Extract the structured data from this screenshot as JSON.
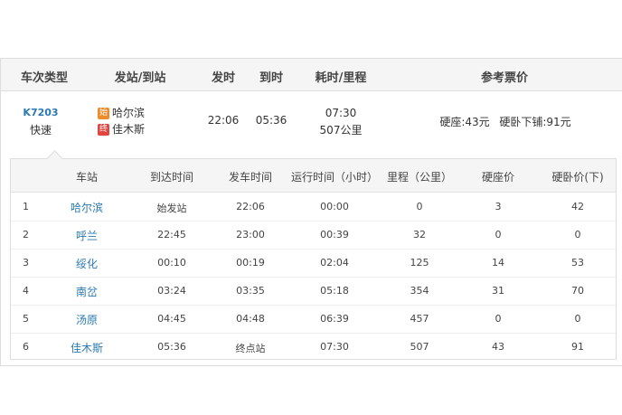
{
  "header": {
    "train_type": "车次类型",
    "from_to": "发站/到站",
    "depart": "发时",
    "arrive": "到时",
    "duration_distance": "耗时/里程",
    "fare": "参考票价"
  },
  "train": {
    "code": "K7203",
    "type": "快速",
    "from_badge": "始",
    "from_station": "哈尔滨",
    "to_badge": "终",
    "to_station": "佳木斯",
    "depart_time": "22:06",
    "arrive_time": "05:36",
    "duration": "07:30",
    "distance": "507公里",
    "fare_hard_seat": "硬座:43元",
    "fare_hard_sleeper": "硬卧下铺:91元"
  },
  "stops_header": {
    "station": "车站",
    "arrive": "到达时间",
    "depart": "发车时间",
    "run_time": "运行时间（小时）",
    "distance": "里程（公里）",
    "hard_seat": "硬座价",
    "hard_sleeper": "硬卧价(下)"
  },
  "stops": [
    {
      "no": "1",
      "station": "哈尔滨",
      "arrive": "始发站",
      "depart": "22:06",
      "run_time": "00:00",
      "distance": "0",
      "hard_seat": "3",
      "hard_sleeper": "42"
    },
    {
      "no": "2",
      "station": "呼兰",
      "arrive": "22:45",
      "depart": "23:00",
      "run_time": "00:39",
      "distance": "32",
      "hard_seat": "0",
      "hard_sleeper": "0"
    },
    {
      "no": "3",
      "station": "绥化",
      "arrive": "00:10",
      "depart": "00:19",
      "run_time": "02:04",
      "distance": "125",
      "hard_seat": "14",
      "hard_sleeper": "53"
    },
    {
      "no": "4",
      "station": "南岔",
      "arrive": "03:24",
      "depart": "03:35",
      "run_time": "05:18",
      "distance": "354",
      "hard_seat": "31",
      "hard_sleeper": "70"
    },
    {
      "no": "5",
      "station": "汤原",
      "arrive": "04:45",
      "depart": "04:48",
      "run_time": "06:39",
      "distance": "457",
      "hard_seat": "0",
      "hard_sleeper": "0"
    },
    {
      "no": "6",
      "station": "佳木斯",
      "arrive": "05:36",
      "depart": "终点站",
      "run_time": "07:30",
      "distance": "507",
      "hard_seat": "43",
      "hard_sleeper": "91"
    }
  ]
}
